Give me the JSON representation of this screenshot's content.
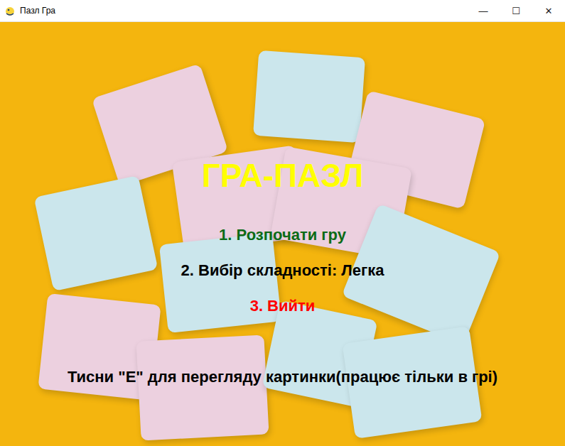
{
  "window": {
    "title": "Пазл Гра",
    "controls": [
      "—",
      "☐",
      "✕"
    ]
  },
  "game_title": "ГРА-ПАЗЛ",
  "menu": [
    {
      "label": "1. Розпочати гру",
      "selected": true,
      "color": "#0c6b16"
    },
    {
      "label": "2. Вибір складності: Легка",
      "selected": false,
      "color": "#000000"
    },
    {
      "label": "3. Вийти",
      "selected": false,
      "color": "#ff0000"
    }
  ],
  "hint": "Тисни \"E\" для перегляду картинки(працює тільки в грі)"
}
